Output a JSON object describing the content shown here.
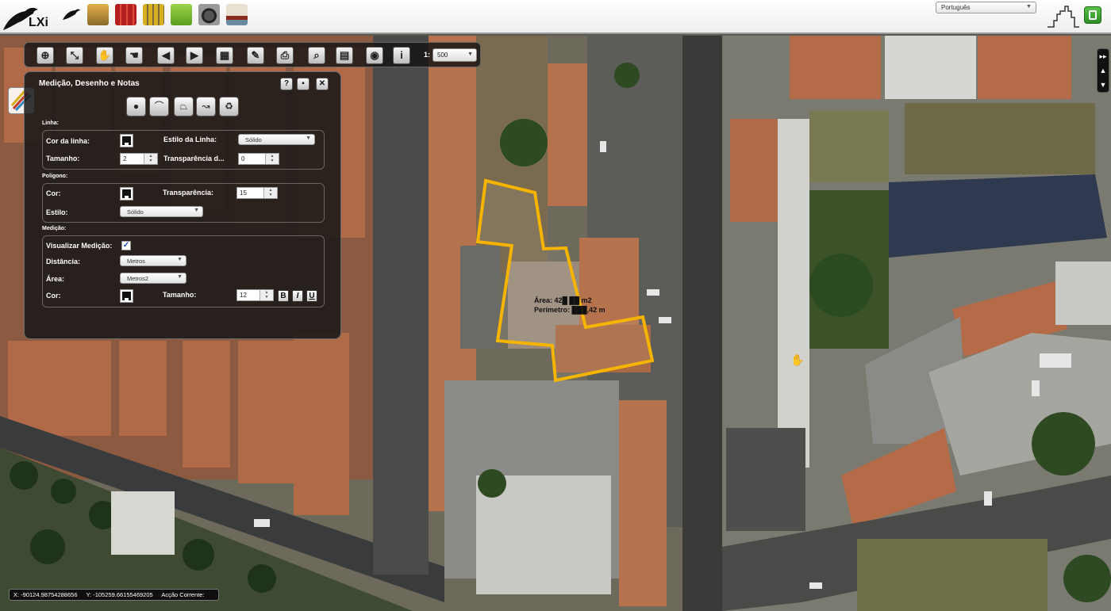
{
  "app": {
    "logo_text": "LXi",
    "app_icons": [
      "bird-app-icon",
      "construction-app-icon",
      "archive-app-icon",
      "yellow-docs-app-icon",
      "green-map-app-icon",
      "camera-app-icon",
      "ship-app-icon"
    ],
    "language": "Português"
  },
  "toolbar": {
    "buttons": [
      {
        "name": "zoom-in-icon",
        "glyph": "⊕"
      },
      {
        "name": "zoom-extent-icon",
        "glyph": "⤡"
      },
      {
        "name": "pan-hand-icon",
        "glyph": "✋"
      },
      {
        "name": "identify-hand-icon",
        "glyph": "☚"
      },
      {
        "name": "back-arrow-icon",
        "glyph": "◀"
      },
      {
        "name": "forward-arrow-icon",
        "glyph": "▶"
      },
      {
        "name": "layers-icon",
        "glyph": "▦"
      },
      {
        "name": "draw-icon",
        "glyph": "✎"
      },
      {
        "name": "print-icon",
        "glyph": "⎙"
      },
      {
        "name": "search-icon",
        "glyph": "⌕"
      },
      {
        "name": "save-icon",
        "glyph": "▤"
      },
      {
        "name": "camera-icon",
        "glyph": "◉"
      },
      {
        "name": "info-icon",
        "glyph": "i"
      }
    ],
    "scale_label": "1:",
    "scale_value": "500"
  },
  "panel": {
    "title": "Medição, Desenho e Notas",
    "linha": {
      "section": "Linha:",
      "cor_label": "Cor da linha:",
      "estilo_label": "Estilo da Linha:",
      "estilo_value": "Sólido",
      "tamanho_label": "Tamanho:",
      "tamanho_value": "2",
      "transparencia_label": "Transparência d...",
      "transparencia_value": "0"
    },
    "poligono": {
      "section": "Poligono:",
      "cor_label": "Cor:",
      "transparencia_label": "Transparência:",
      "transparencia_value": "15",
      "estilo_label": "Estilo:",
      "estilo_value": "Sólido"
    },
    "medicao": {
      "section": "Medição:",
      "visualizar_label": "Visualizar Medição:",
      "visualizar_checked": true,
      "distancia_label": "Distância:",
      "distancia_value": "Metros",
      "area_label": "Área:",
      "area_value": "Metros2",
      "cor_label": "Cor:",
      "tamanho_label": "Tamanho:",
      "tamanho_value": "12",
      "bold": "B",
      "italic": "I",
      "underline": "U"
    }
  },
  "measurement": {
    "area": "Área: 42█ ██ m2",
    "perimeter": "Perímetro: ███,42 m"
  },
  "status": {
    "x": "X: -90124.98754288656",
    "y": "Y: -105259.66155469205",
    "accao": "Acção Corrente:"
  },
  "colors": {
    "polygon_outline": "#f5b400",
    "panel_bg": "#161616"
  }
}
